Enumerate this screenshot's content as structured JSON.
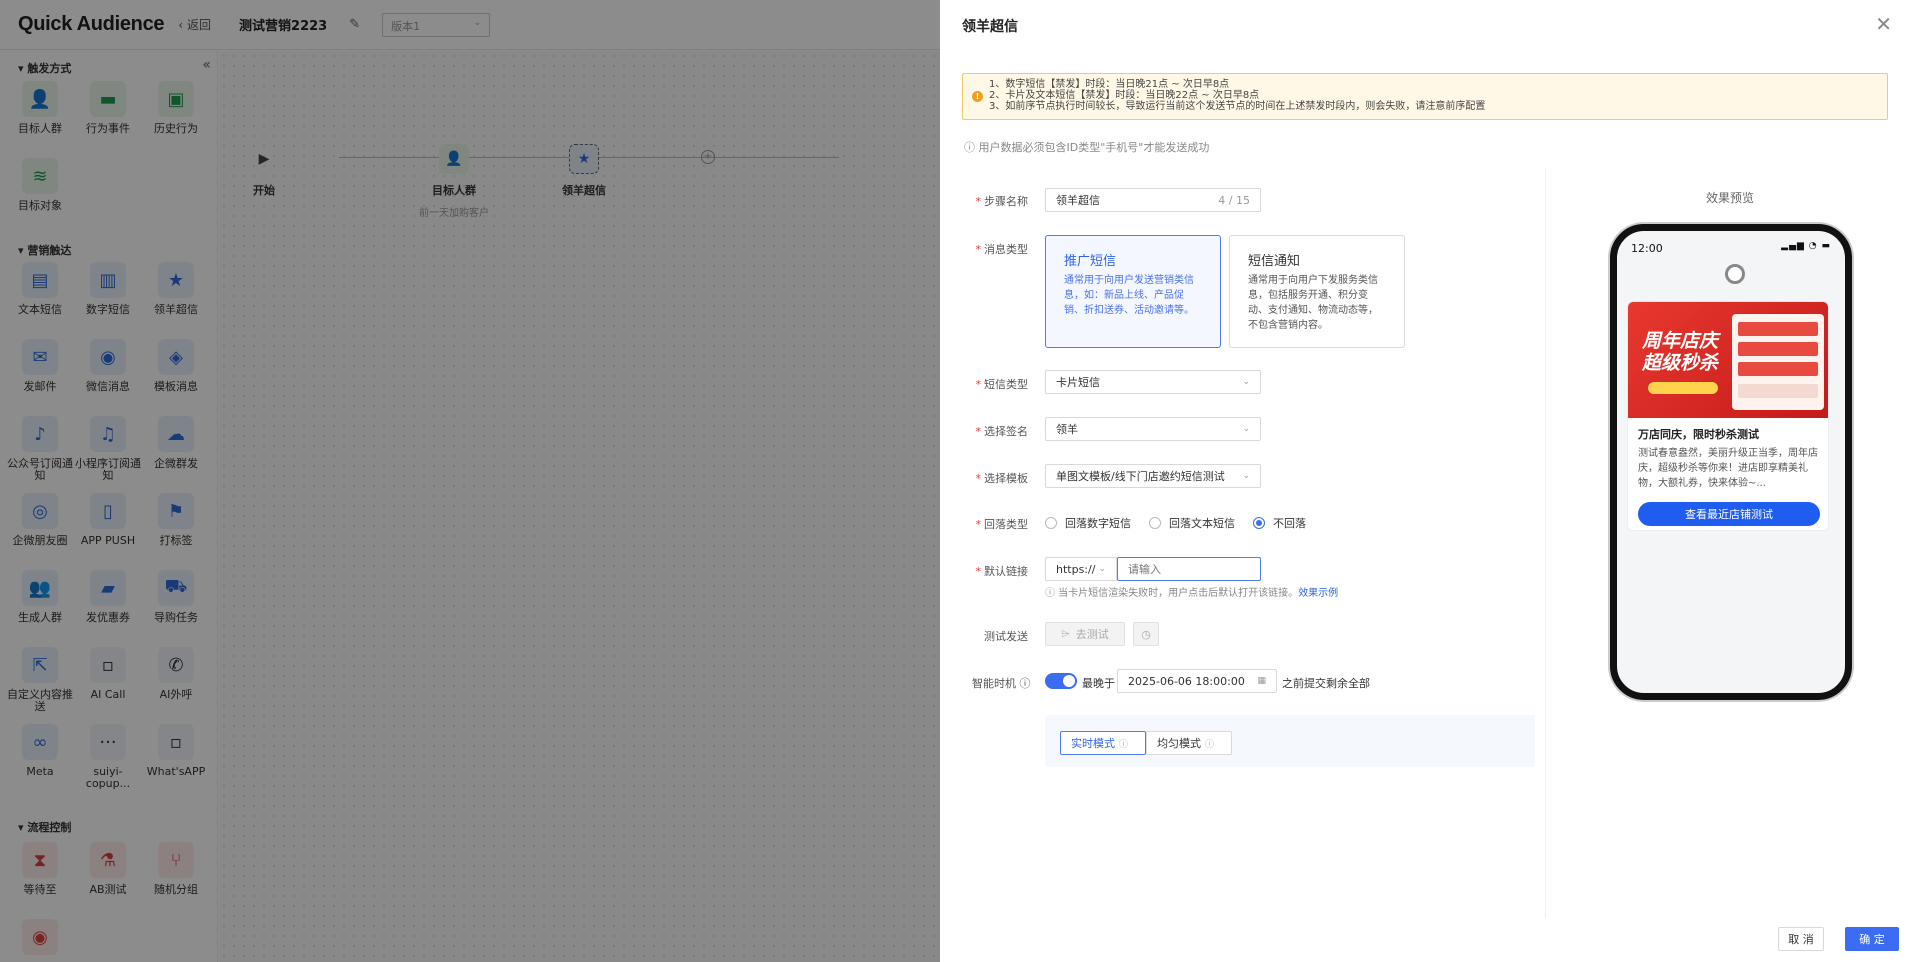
{
  "app": {
    "brand": "Quick Audience",
    "back": "返回",
    "flow_title": "测试营销2223",
    "version_placeholder": "版本1"
  },
  "palette": {
    "sections": [
      {
        "title": "触发方式",
        "tools": [
          "目标人群",
          "行为事件",
          "历史行为",
          "目标对象"
        ]
      },
      {
        "title": "营销触达",
        "tools": [
          "文本短信",
          "数字短信",
          "领羊超信",
          "发邮件",
          "微信消息",
          "模板消息",
          "公众号订阅通知",
          "小程序订阅通知",
          "企微群发",
          "企微朋友圈",
          "APP PUSH",
          "打标签",
          "生成人群",
          "发优惠券",
          "导购任务",
          "自定义内容推送",
          "AI Call",
          "AI外呼",
          "Meta",
          "suiyi-copup...",
          "What'sAPP"
        ]
      },
      {
        "title": "流程控制",
        "tools": [
          "等待至",
          "AB测试",
          "随机分组"
        ]
      }
    ]
  },
  "canvas": {
    "nodes": [
      {
        "label": "开始",
        "sub": ""
      },
      {
        "label": "目标人群",
        "sub": "前一天加购客户"
      },
      {
        "label": "领羊超信",
        "sub": ""
      }
    ]
  },
  "drawer": {
    "title": "领羊超信",
    "notice": [
      "1、数字短信【禁发】时段：当日晚21点 ~ 次日早8点",
      "2、卡片及文本短信【禁发】时段：当日晚22点 ~ 次日早8点",
      "3、如前序节点执行时间较长，导致运行当前这个发送节点的时间在上述禁发时段内，则会失败，请注意前序配置"
    ],
    "tip": "ⓘ 用户数据必须包含ID类型\"手机号\"才能发送成功",
    "form": {
      "step_name_label": "步骤名称",
      "step_name_value": "领羊超信",
      "step_name_count": "4 / 15",
      "msg_type_label": "消息类型",
      "msg_types": [
        {
          "title": "推广短信",
          "desc": "通常用于向用户发送营销类信息，如：新品上线、产品促销、折扣送券、活动邀请等。"
        },
        {
          "title": "短信通知",
          "desc": "通常用于向用户下发服务类信息，包括服务开通、积分变动、支付通知、物流动态等，不包含营销内容。"
        }
      ],
      "sms_type_label": "短信类型",
      "sms_type_value": "卡片短信",
      "signature_label": "选择签名",
      "signature_value": "领羊",
      "template_label": "选择模板",
      "template_value": "单图文模板/线下门店邀约短信测试",
      "fallback_label": "回落类型",
      "fallback_options": [
        "回落数字短信",
        "回落文本短信",
        "不回落"
      ],
      "link_label": "默认链接",
      "link_protocol": "https://",
      "link_placeholder": "请输入",
      "link_hint": "ⓘ 当卡片短信渲染失败时，用户点击后默认打开该链接。",
      "link_hint_link": "效果示例",
      "test_label": "测试发送",
      "test_button": "去测试",
      "smart_label": "智能时机",
      "smart_prefix": "最晚于",
      "smart_datetime": "2025-06-06 18:00:00",
      "smart_suffix": "之前提交剩余全部",
      "modes": [
        "实时模式",
        "均匀模式"
      ]
    },
    "preview": {
      "title": "效果预览",
      "time": "12:00",
      "banner_text": "周年店庆 超级秒杀",
      "headline": "万店同庆，限时秒杀测试",
      "body": "测试春意盎然，美丽升级正当季，周年店庆，超级秒杀等你来！进店即享精美礼物，大额礼券，快来体验~...",
      "cta": "查看最近店铺测试"
    },
    "footer": {
      "cancel": "取 消",
      "ok": "确 定"
    }
  },
  "colors": {
    "primary": "#3b6cf2",
    "warning_bg": "#fff8e6",
    "warning_border": "#f5c86a",
    "banner": "#e8382f"
  }
}
